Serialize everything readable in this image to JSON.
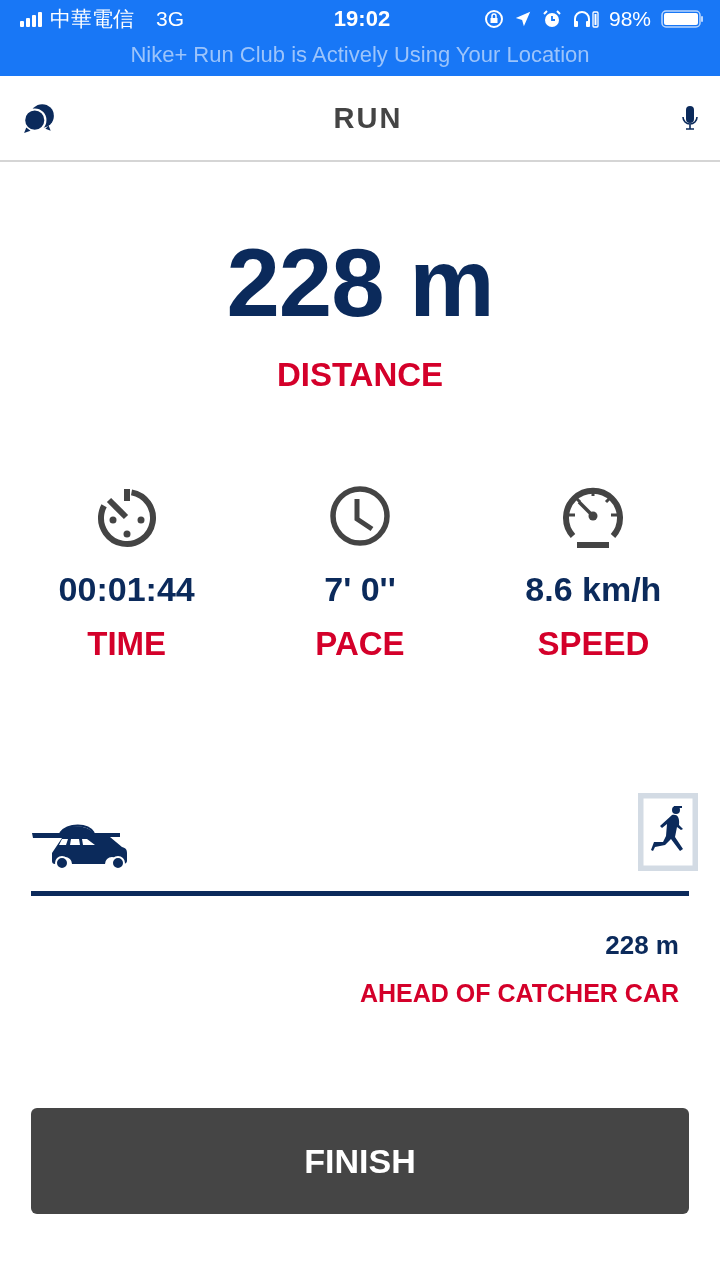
{
  "status_bar": {
    "carrier": "中華電信",
    "network": "3G",
    "time": "19:02",
    "battery": "98%"
  },
  "banner": "Nike+ Run Club is Actively Using Your Location",
  "header": {
    "title": "RUN"
  },
  "distance": {
    "value": "228 m",
    "label": "DISTANCE"
  },
  "stats": [
    {
      "kind": "time",
      "value": "00:01:44",
      "label": "TIME"
    },
    {
      "kind": "pace",
      "value": "7' 0''",
      "label": "PACE"
    },
    {
      "kind": "speed",
      "value": "8.6 km/h",
      "label": "SPEED"
    }
  ],
  "catcher": {
    "value": "228 m",
    "label": "AHEAD OF CATCHER CAR"
  },
  "finish_button": "FINISH"
}
